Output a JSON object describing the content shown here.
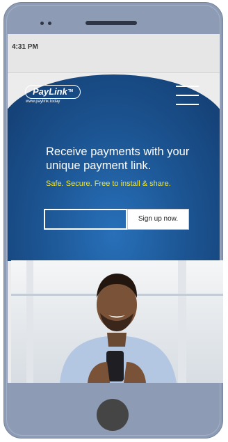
{
  "status_bar": {
    "time": "4:31 PM"
  },
  "header": {
    "logo_text": "PayLink",
    "logo_tm": "TM",
    "logo_url": "www.paylink.today"
  },
  "hero": {
    "title": "Receive payments with your unique payment link.",
    "tagline": "Safe. Secure. Free to install & share."
  },
  "signup": {
    "input_value": "",
    "button_label": "Sign up now."
  },
  "colors": {
    "hero_blue": "#1c5593",
    "tagline_yellow": "#f2e526",
    "phone_frame": "#8d9cb4"
  }
}
